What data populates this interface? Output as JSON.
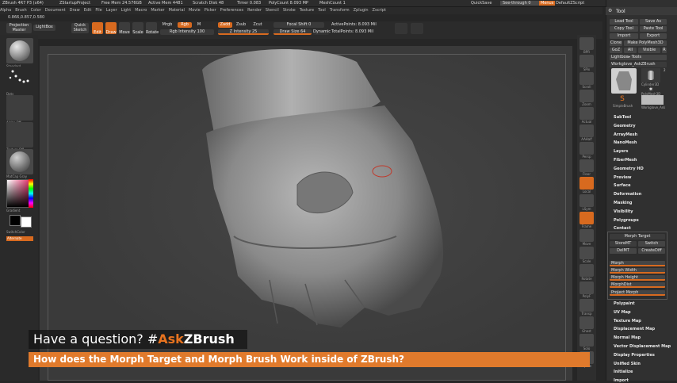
{
  "title_bar": {
    "app": "ZBrush 4R7 P3 (x64)",
    "project": "ZStartupProject",
    "free_mem": "Free Mem 24.576GB",
    "active_mem": "Active Mem 4481",
    "scratch_disk": "Scratch Disk 48",
    "timer": "Timer 0.083",
    "poly_count": "PolyCount 8.093 MP",
    "mesh_count": "MeshCount 1",
    "quicksave": "QuickSave",
    "see_through": "See-through 0",
    "menus": "Menus",
    "default_script": "DefaultZScript"
  },
  "menubar": [
    "Alpha",
    "Brush",
    "Color",
    "Document",
    "Draw",
    "Edit",
    "File",
    "Layer",
    "Light",
    "Macro",
    "Marker",
    "Material",
    "Movie",
    "Picker",
    "Preferences",
    "Render",
    "Stencil",
    "Stroke",
    "Texture",
    "Tool",
    "Transform",
    "Zplugin",
    "Zscript"
  ],
  "coords": "0.866,0.857,0.580",
  "shelf": {
    "projection_master": "Projection Master",
    "lightbox": "LightBox",
    "quick_sketch": "Quick Sketch",
    "edit": "Edit",
    "draw": "Draw",
    "move": "Move",
    "scale": "Scale",
    "rotate": "Rotate",
    "mrgb": "Mrgb",
    "rgb": "Rgb",
    "m": "M",
    "zadd": "Zadd",
    "zsub": "Zsub",
    "zcut": "Zcut",
    "rgb_intensity": "Rgb Intensity 100",
    "z_intensity": "Z Intensity 25",
    "focal_shift": "Focal Shift 0",
    "draw_size": "Draw Size 64",
    "dynamic": "Dynamic",
    "active_points": "ActivePoints: 8.093 Mil",
    "total_points": "TotalPoints: 8.093 Mil"
  },
  "left_tray": {
    "brush_label": "Standard",
    "stroke_label": "Dots",
    "alpha_label": "Alpha Off",
    "texture_label": "Texture Off",
    "material_label": "MatCap Gray",
    "gradient": "Gradient",
    "switch_color": "SwitchColor",
    "alternate": "Alternate"
  },
  "icon_strip": [
    "BPR",
    "SPix",
    "Scroll",
    "Zoom",
    "Actual",
    "AAHalf",
    "Persp",
    "Floor",
    "Local",
    "LSym",
    "Frame",
    "Move",
    "Scale",
    "Rotate",
    "PolyF",
    "Transp",
    "Ghost",
    "Solo",
    "Xpose"
  ],
  "tool_palette": {
    "header": "Tool",
    "load_tool": "Load Tool",
    "save_as": "Save As",
    "copy_tool": "Copy Tool",
    "paste_tool": "Paste Tool",
    "import": "Import",
    "export": "Export",
    "clone": "Clone",
    "make_polymesh": "Make PolyMesh3D",
    "goz": "GoZ",
    "all": "All",
    "visible": "Visible",
    "r": "R",
    "lightbox_tools": "Lightbox▸ Tools",
    "current_tool": "Workglove_AskZBrush",
    "tools": [
      "Cylinder3D",
      "PolyMesh3D",
      "SimpleBrush",
      "Workglove_Ask"
    ],
    "count_badge": "2",
    "sections": [
      "SubTool",
      "Geometry",
      "ArrayMesh",
      "NanoMesh",
      "Layers",
      "FiberMesh",
      "Geometry HD",
      "Preview",
      "Surface",
      "Deformation",
      "Masking",
      "Visibility",
      "Polygroups",
      "Contact"
    ],
    "morph_target": {
      "title": "Morph Target",
      "storemt": "StoreMT",
      "switch": "Switch",
      "delmt": "DelMT",
      "creatediff": "CreateDiff",
      "sliders": [
        "Morph",
        "Morph Width",
        "Morph Height",
        "MorphDist"
      ],
      "project_morph": "Project Morph"
    },
    "sections_after": [
      "Polypaint",
      "UV Map",
      "Texture Map",
      "Displacement Map",
      "Normal Map",
      "Vector Displacement Map",
      "Display Properties",
      "Unified Skin",
      "Initialize",
      "Import"
    ]
  },
  "captions": {
    "question_prefix": "Have a question? #",
    "question_tag": "Ask",
    "question_brand": "ZBrush",
    "subtitle": "How does the Morph Target and Morph Brush Work inside of ZBrush?"
  }
}
